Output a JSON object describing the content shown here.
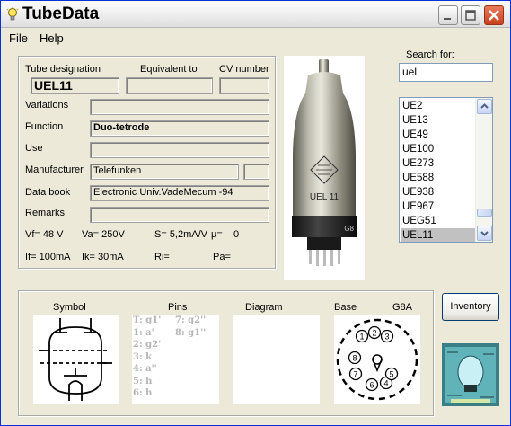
{
  "window": {
    "title": "TubeData"
  },
  "menu": [
    "File",
    "Help"
  ],
  "fields": {
    "designation_label": "Tube designation",
    "equivalent_label": "Equivalent to",
    "cv_label": "CV number",
    "designation_value": "UEL11",
    "equivalent_value": "",
    "cv_value": "",
    "variations_label": "Variations",
    "variations_value": "",
    "function_label": "Function",
    "function_value": "Duo-tetrode",
    "use_label": "Use",
    "use_value": "",
    "manufacturer_label": "Manufacturer",
    "manufacturer_value": "Telefunken",
    "manufacturer_extra": "",
    "databook_label": "Data book",
    "databook_value": "Electronic Univ.VadeMecum -94",
    "remarks_label": "Remarks",
    "remarks_value": ""
  },
  "params": {
    "vf": "Vf= 48 V",
    "va": "Va=  250V",
    "s": "S= 5,2mA/V",
    "mu": "µ=",
    "mu_value": "0",
    "if": "If= 100mA",
    "ik": "Ik=  30mA",
    "ri": "Ri=",
    "pa": "Pa="
  },
  "photo": {
    "tube_label": "UEL 11",
    "base_label": "G8"
  },
  "search": {
    "label": "Search for:",
    "value": "uel"
  },
  "list": {
    "items": [
      "UE2",
      "UE13",
      "UE49",
      "UE100",
      "UE273",
      "UE588",
      "UE938",
      "UE967",
      "UEG51",
      "UEL11"
    ],
    "selected": "UEL11"
  },
  "bottom": {
    "symbol_label": "Symbol",
    "pins_label": "Pins",
    "diagram_label": "Diagram",
    "base_label": "Base",
    "base_type": "G8A",
    "pins_col1": [
      "T: g1'",
      "1: a'",
      "2: g2'",
      "3: k",
      "4: a''",
      "5: h",
      "6: h"
    ],
    "pins_col2": [
      "7: g2''",
      "8: g1''"
    ],
    "base_pin_numbers": [
      "1",
      "2",
      "3",
      "4",
      "5",
      "6",
      "7",
      "8"
    ]
  },
  "buttons": {
    "inventory": "Inventory"
  },
  "colors": {
    "title_close": "#d9532f",
    "selection": "#c1c1c1",
    "pins_text": "#b5b5b5"
  }
}
